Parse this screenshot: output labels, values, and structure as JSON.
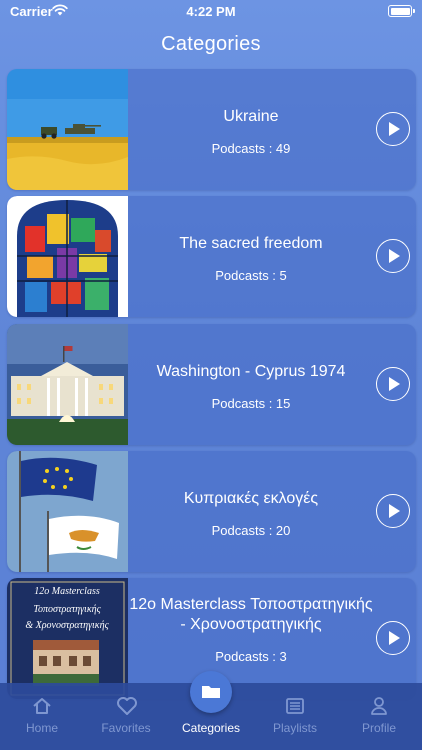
{
  "status_bar": {
    "carrier": "Carrier",
    "time": "4:22 PM"
  },
  "header": {
    "title": "Categories"
  },
  "categories": [
    {
      "title": "Ukraine",
      "count": "Podcasts : 49"
    },
    {
      "title": "The sacred freedom",
      "count": "Podcasts : 5"
    },
    {
      "title": "Washington - Cyprus 1974",
      "count": "Podcasts : 15"
    },
    {
      "title": "Κυπριακές εκλογές",
      "count": "Podcasts : 20"
    },
    {
      "title": "12ο Masterclass Τοποστρατηγικής - Χρονοστρατηγικής",
      "count": "Podcasts : 3"
    }
  ],
  "thumb5_text": {
    "line1": "12ο Masterclass",
    "line2": "Τοποστρατηγικής",
    "line3": "& Χρονοστρατηγικής"
  },
  "tabs": [
    {
      "label": "Home",
      "icon": "home-icon"
    },
    {
      "label": "Favorites",
      "icon": "heart-icon"
    },
    {
      "label": "Categories",
      "icon": "folder-icon"
    },
    {
      "label": "Playlists",
      "icon": "list-icon"
    },
    {
      "label": "Profile",
      "icon": "person-icon"
    }
  ],
  "active_tab": "Categories"
}
